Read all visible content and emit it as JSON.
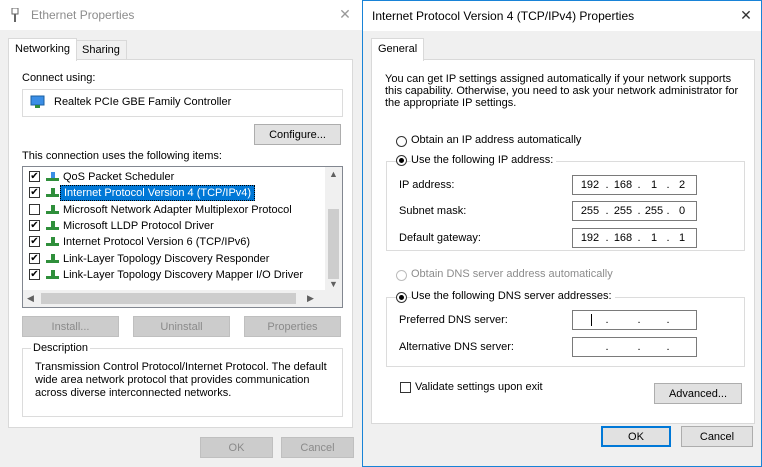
{
  "left_window": {
    "title": "Ethernet Properties",
    "tabs": [
      "Networking",
      "Sharing"
    ],
    "connect_using_label": "Connect using:",
    "adapter_name": "Realtek PCIe GBE Family Controller",
    "configure_button": "Configure...",
    "items_label": "This connection uses the following items:",
    "items": [
      {
        "label": "QoS Packet Scheduler",
        "checked": true
      },
      {
        "label": "Internet Protocol Version 4 (TCP/IPv4)",
        "checked": true,
        "selected": true
      },
      {
        "label": "Microsoft Network Adapter Multiplexor Protocol",
        "checked": false
      },
      {
        "label": "Microsoft LLDP Protocol Driver",
        "checked": true
      },
      {
        "label": "Internet Protocol Version 6 (TCP/IPv6)",
        "checked": true
      },
      {
        "label": "Link-Layer Topology Discovery Responder",
        "checked": true
      },
      {
        "label": "Link-Layer Topology Discovery Mapper I/O Driver",
        "checked": true
      }
    ],
    "install_button": "Install...",
    "uninstall_button": "Uninstall",
    "properties_button": "Properties",
    "description_label": "Description",
    "description_text": "Transmission Control Protocol/Internet Protocol. The default wide area network protocol that provides communication across diverse interconnected networks.",
    "ok_button": "OK",
    "cancel_button": "Cancel"
  },
  "right_window": {
    "title": "Internet Protocol Version 4 (TCP/IPv4) Properties",
    "tab": "General",
    "intro_text": "You can get IP settings assigned automatically if your network supports this capability. Otherwise, you need to ask your network administrator for the appropriate IP settings.",
    "obtain_ip_auto": "Obtain an IP address automatically",
    "use_following_ip": "Use the following IP address:",
    "ip_address_label": "IP address:",
    "ip_address": [
      "192",
      "168",
      "1",
      "2"
    ],
    "subnet_mask_label": "Subnet mask:",
    "subnet_mask": [
      "255",
      "255",
      "255",
      "0"
    ],
    "default_gateway_label": "Default gateway:",
    "default_gateway": [
      "192",
      "168",
      "1",
      "1"
    ],
    "obtain_dns_auto": "Obtain DNS server address automatically",
    "use_following_dns": "Use the following DNS server addresses:",
    "preferred_dns_label": "Preferred DNS server:",
    "alternative_dns_label": "Alternative DNS server:",
    "validate_label": "Validate settings upon exit",
    "advanced_button": "Advanced...",
    "ok_button": "OK",
    "cancel_button": "Cancel"
  },
  "colors": {
    "accent": "#0078d7",
    "window_border": "#1883d7"
  },
  "icons": {
    "window_icon": "network-adapter-icon",
    "close": "close-icon",
    "protocol": "network-protocol-icon"
  }
}
